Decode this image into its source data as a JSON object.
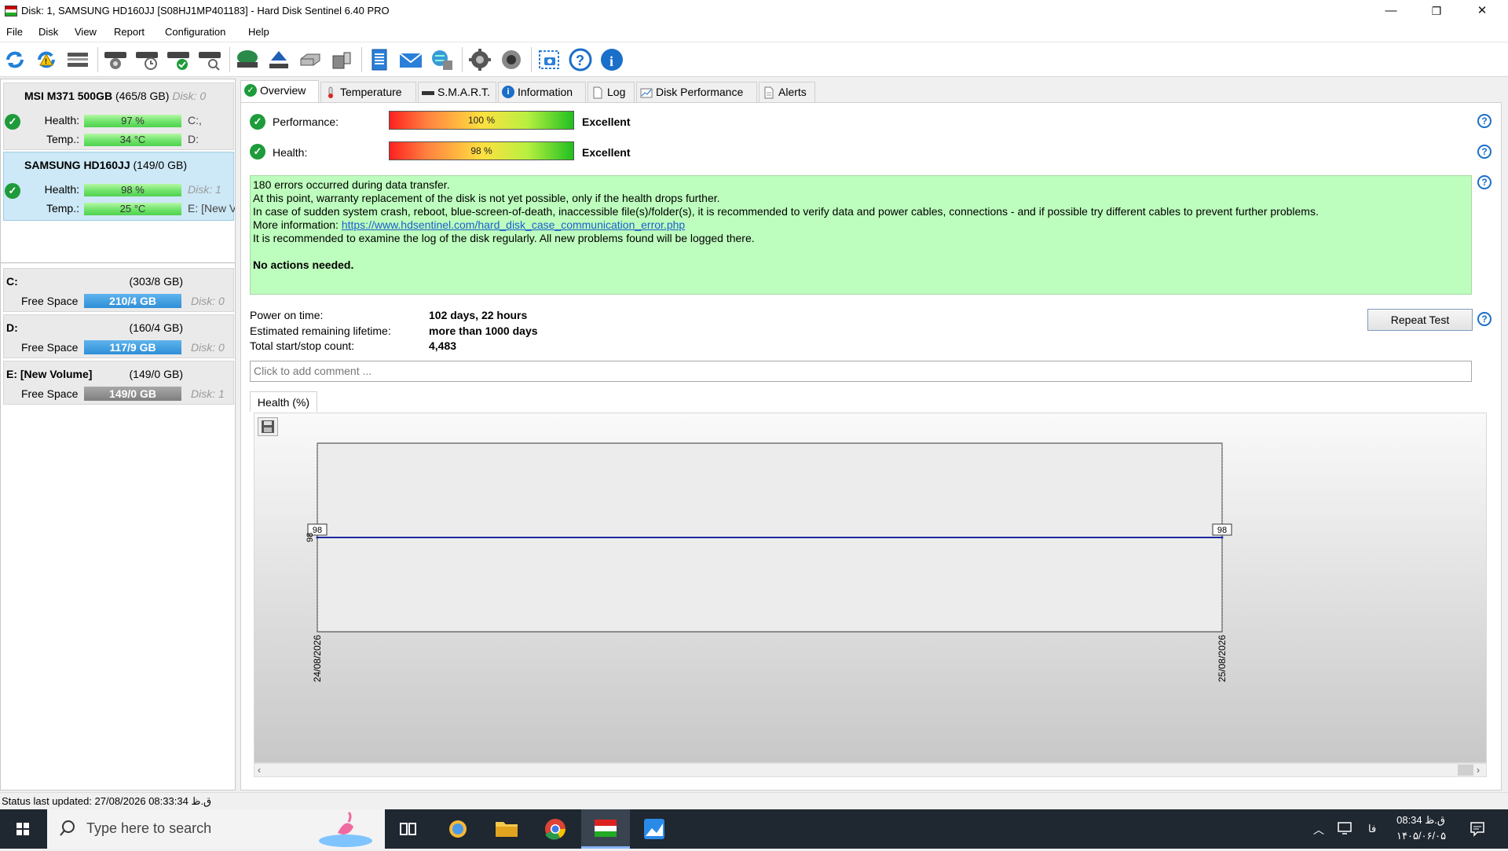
{
  "window": {
    "title": "Disk: 1, SAMSUNG HD160JJ [S08HJ1MP401183]  -  Hard Disk Sentinel 6.40 PRO",
    "minimize": "—",
    "maximize": "❐",
    "close": "✕"
  },
  "menu": [
    "File",
    "Disk",
    "View",
    "Report",
    "Configuration",
    "Help"
  ],
  "toolbar_icons": [
    "refresh-icon",
    "refresh-warning-icon",
    "disk-list-icon",
    "disk-test-icon",
    "disk-schedule-icon",
    "disk-ok-icon",
    "disk-search-icon",
    "surface-test-icon",
    "eject-icon",
    "drive-icon",
    "usb-drive-icon",
    "report-icon",
    "mail-icon",
    "network-icon",
    "settings-icon",
    "sound-icon",
    "screenshot-icon",
    "help-icon",
    "info-icon"
  ],
  "disks": [
    {
      "name": "MSI M371 500GB",
      "size": "(465/8 GB)",
      "disk_label": "Disk: 0",
      "health_label": "Health:",
      "health": "97 %",
      "temp_label": "Temp.:",
      "temp": "34 °C",
      "side1": "C:,",
      "side2": "D:"
    },
    {
      "name": "SAMSUNG HD160JJ",
      "size": "(149/0 GB)",
      "disk_label": "Disk: 1",
      "health_label": "Health:",
      "health": "98 %",
      "temp_label": "Temp.:",
      "temp": "25 °C",
      "side1": "Disk: 1",
      "side2": "E: [New V"
    }
  ],
  "volumes": [
    {
      "name": "C:",
      "size": "(303/8 GB)",
      "free_label": "Free Space",
      "free": "210/4 GB",
      "disk": "Disk: 0",
      "color": "#2f8fd8"
    },
    {
      "name": "D:",
      "size": "(160/4 GB)",
      "free_label": "Free Space",
      "free": "117/9 GB",
      "disk": "Disk: 0",
      "color": "#2f8fd8"
    },
    {
      "name": "E: [New Volume]",
      "size": "(149/0 GB)",
      "free_label": "Free Space",
      "free": "149/0 GB",
      "disk": "Disk: 1",
      "color": "#8a8a8a"
    }
  ],
  "tabs": [
    "Overview",
    "Temperature",
    "S.M.A.R.T.",
    "Information",
    "Log",
    "Disk Performance",
    "Alerts"
  ],
  "overview": {
    "performance_label": "Performance:",
    "performance_value": "100 %",
    "performance_rating": "Excellent",
    "performance_fraction": 1.0,
    "health_label": "Health:",
    "health_value": "98 %",
    "health_rating": "Excellent",
    "health_fraction": 0.98,
    "message": {
      "line1": "180 errors occurred during data transfer.",
      "line2": "At this point, warranty replacement of the disk is not yet possible, only if the health drops further.",
      "line3": "In case of sudden system crash, reboot, blue-screen-of-death, inaccessible file(s)/folder(s), it is recommended to verify data and power cables, connections - and if possible try different cables to prevent further problems.",
      "line4_prefix": "More information:  ",
      "link": "https://www.hdsentinel.com/hard_disk_case_communication_error.php",
      "line5": "It is recommended to examine the log of the disk regularly. All new problems found will be logged there.",
      "line6": "No actions needed."
    },
    "power_on_label": "Power on time:",
    "power_on_value": "102 days, 22 hours",
    "lifetime_label": "Estimated remaining lifetime:",
    "lifetime_value": "more than 1000 days",
    "startstop_label": "Total start/stop count:",
    "startstop_value": "4,483",
    "repeat_button": "Repeat Test",
    "comment_placeholder": "Click to add comment ...",
    "chart_tab": "Health (%)"
  },
  "chart_data": {
    "type": "line",
    "title": "",
    "xlabel": "",
    "ylabel": "",
    "x": [
      "24/08/2026",
      "25/08/2026"
    ],
    "series": [
      {
        "values": [
          98,
          98
        ],
        "color": "#1a2aa0"
      }
    ],
    "point_labels": [
      "98",
      "98"
    ],
    "y_tick_labels": [
      "98"
    ],
    "ylim": [
      97,
      99
    ]
  },
  "status": "Status last updated: 27/08/2026 08:33:34 ق.ظ",
  "taskbar": {
    "search_placeholder": "Type here to search",
    "lang": "فا",
    "time": "08:34 ق.ظ",
    "date": "۱۴۰۵/۰۶/۰۵"
  }
}
